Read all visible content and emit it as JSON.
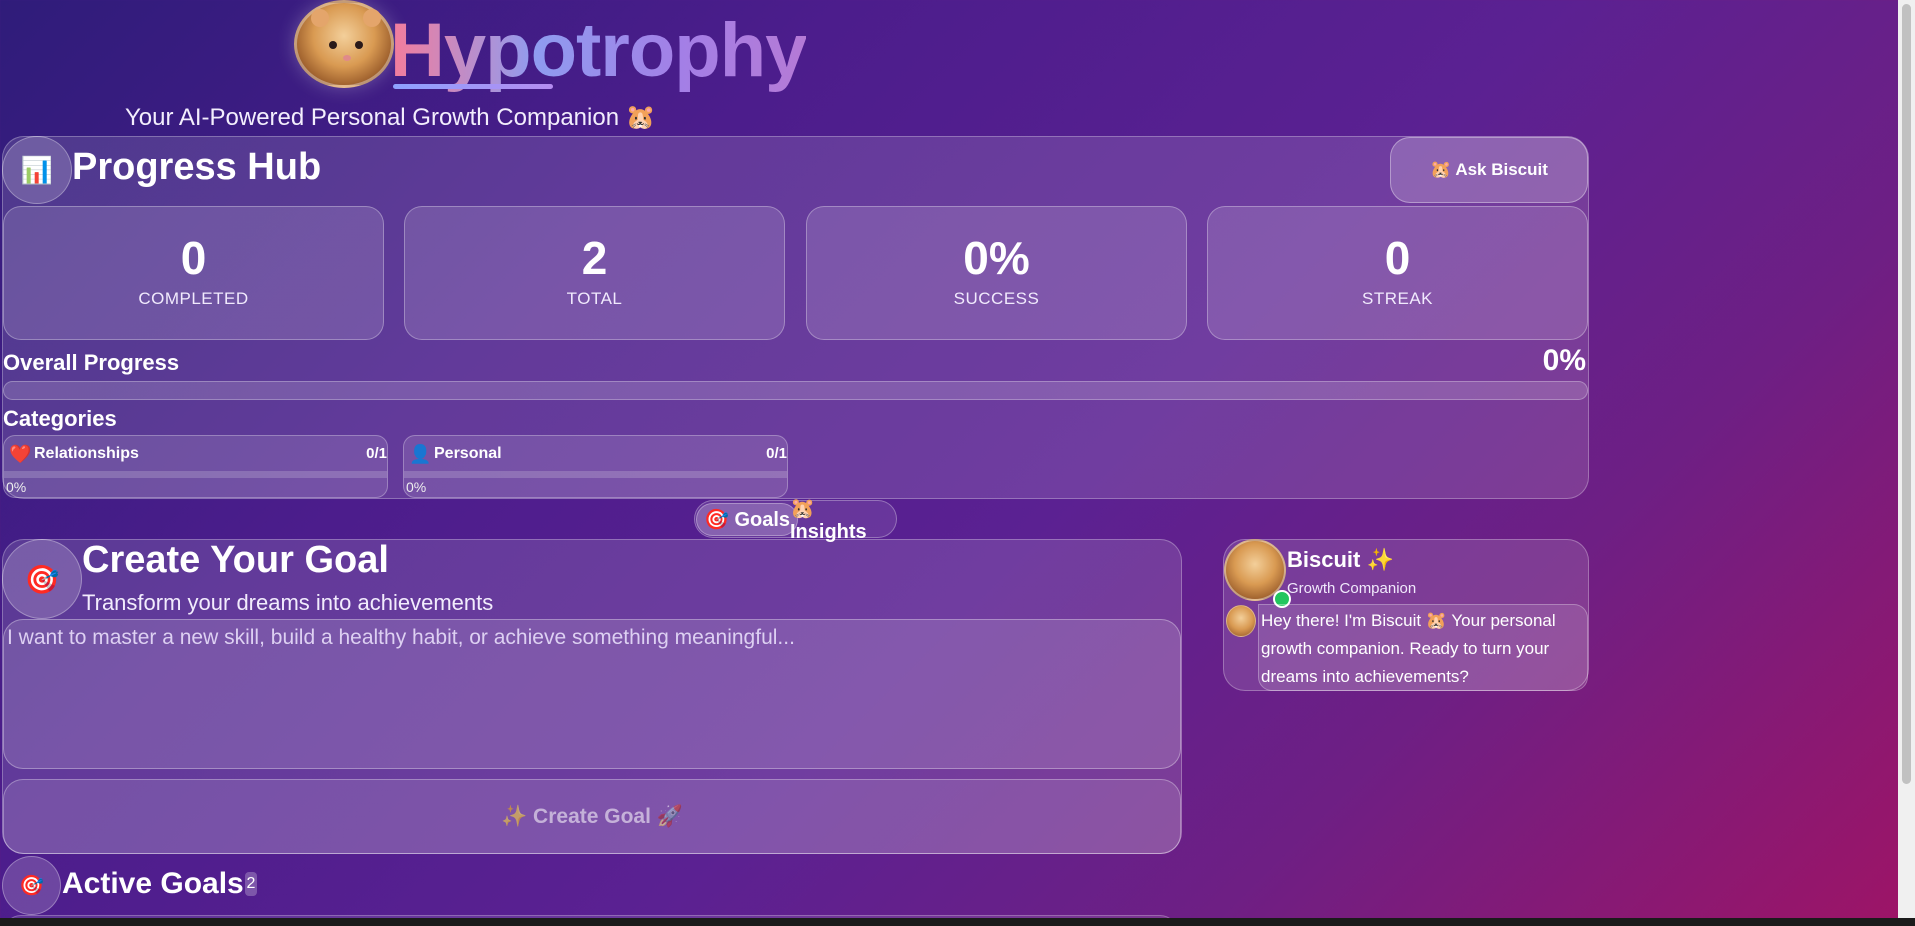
{
  "app": {
    "title": "Hypotrophy",
    "subtitle": "Your AI-Powered Personal Growth Companion 🐹"
  },
  "progress_hub": {
    "icon": "📊",
    "title": "Progress Hub",
    "ask_button": "🐹 Ask Biscuit",
    "stats": [
      {
        "value": "0",
        "label": "COMPLETED"
      },
      {
        "value": "2",
        "label": "TOTAL"
      },
      {
        "value": "0%",
        "label": "SUCCESS"
      },
      {
        "value": "0",
        "label": "STREAK"
      }
    ],
    "overall_label": "Overall Progress",
    "overall_value": "0%",
    "overall_fraction": 0,
    "categories_title": "Categories",
    "categories": [
      {
        "icon": "❤️",
        "name": "Relationships",
        "count": "0/1",
        "percent": "0%",
        "fraction": 0
      },
      {
        "icon": "👤",
        "name": "Personal",
        "count": "0/1",
        "percent": "0%",
        "fraction": 0
      }
    ]
  },
  "tabs": [
    {
      "label": "🎯 Goals",
      "active": true
    },
    {
      "label": "🐹 Insights",
      "active": false
    }
  ],
  "create_goal": {
    "icon": "🎯",
    "title": "Create Your Goal",
    "subtitle": "Transform your dreams into achievements",
    "input_placeholder": "I want to master a new skill, build a healthy habit, or achieve something meaningful...",
    "input_value": "",
    "button_label": "✨ Create Goal 🚀"
  },
  "active_goals": {
    "icon": "🎯",
    "title": "Active Goals",
    "count": "2"
  },
  "chat": {
    "name": "Biscuit ✨",
    "role": "Growth Companion",
    "online_color": "#22c55e",
    "message": "Hey there! I'm Biscuit 🐹 Your personal growth companion. Ready to turn your dreams into achievements?"
  },
  "icons": {
    "logo": "hamster-avatar-icon",
    "online": "online-status-icon"
  }
}
